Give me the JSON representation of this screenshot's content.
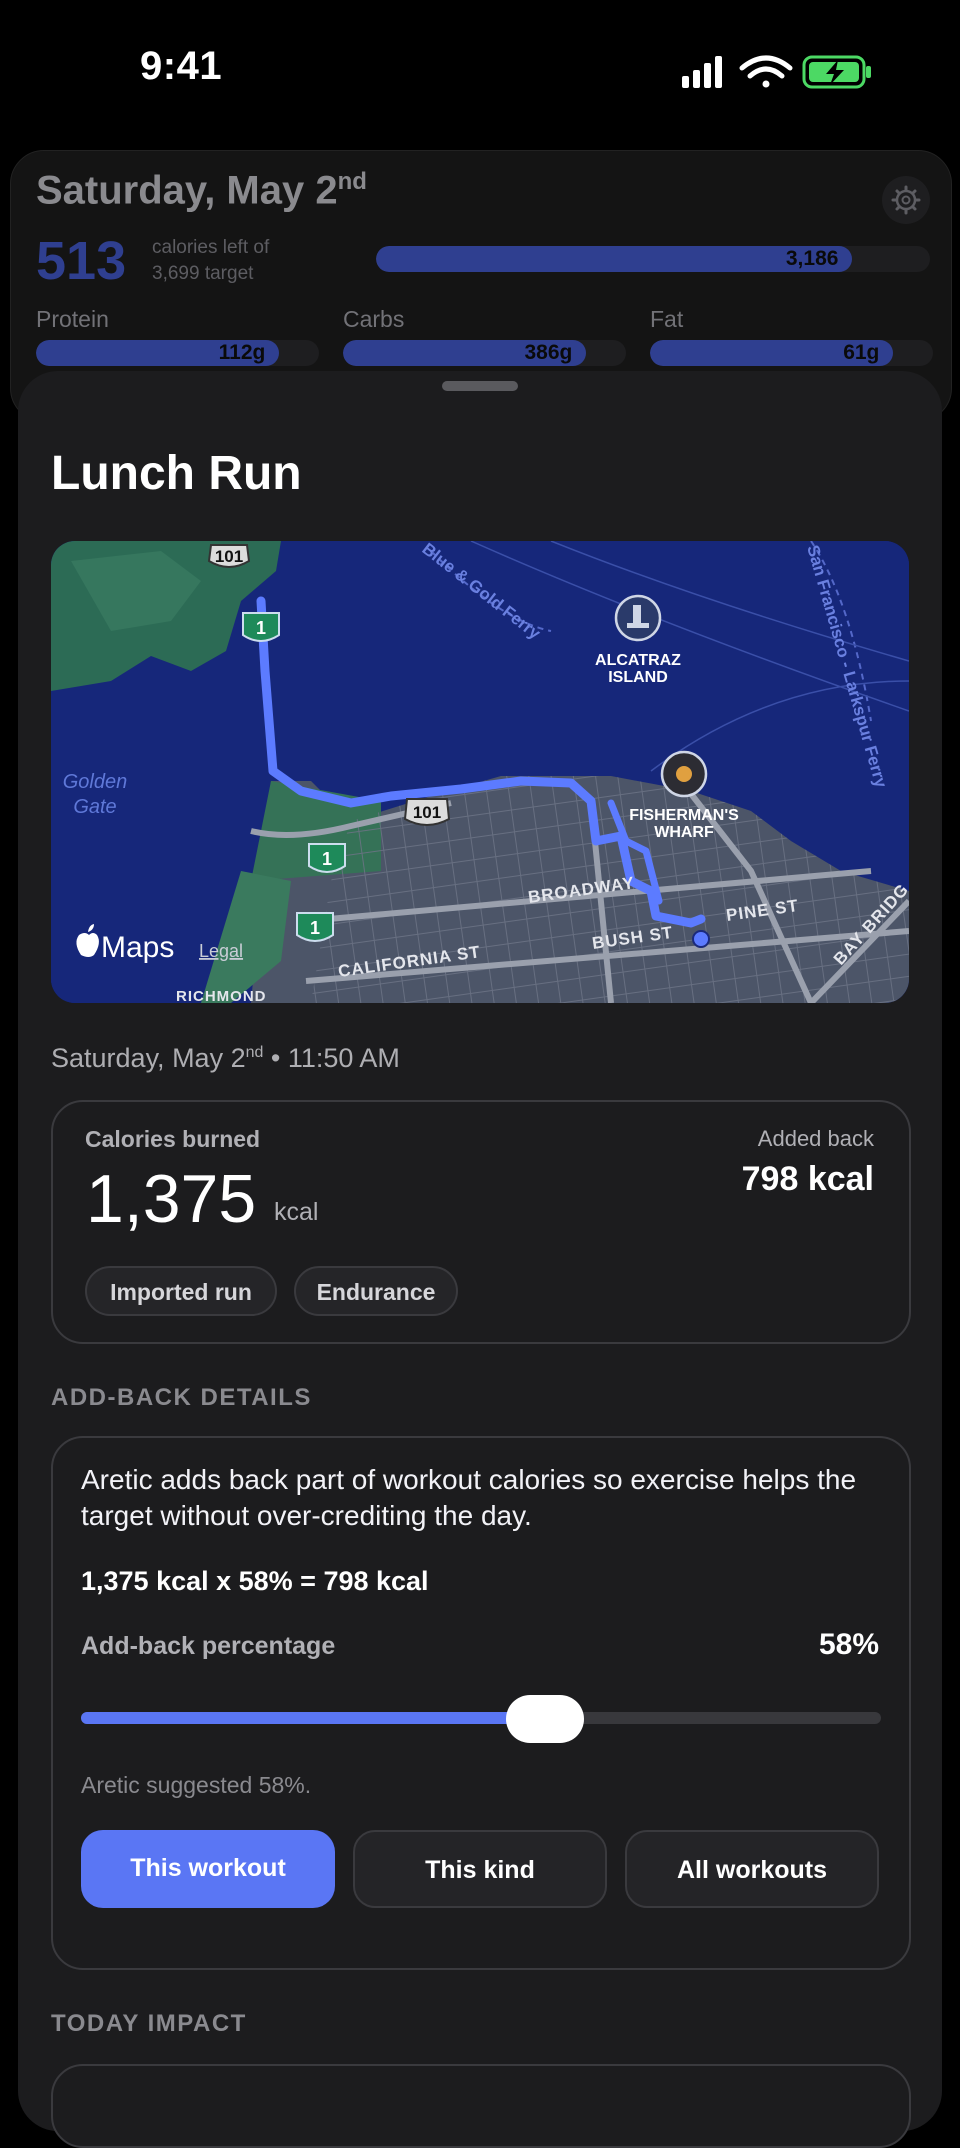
{
  "status": {
    "time": "9:41"
  },
  "summary": {
    "date": "Saturday, May 2",
    "date_suffix": "nd",
    "calories_left": "513",
    "left_line1": "calories left of",
    "left_line2": "3,699 target",
    "eaten_value": "3,186",
    "eaten_fraction": 0.86,
    "macros": [
      {
        "label": "Protein",
        "value": "112g",
        "fraction": 0.86
      },
      {
        "label": "Carbs",
        "value": "386g",
        "fraction": 0.86
      },
      {
        "label": "Fat",
        "value": "61g",
        "fraction": 0.86
      }
    ]
  },
  "workout": {
    "title": "Lunch Run",
    "date": "Saturday, May 2",
    "date_suffix": "nd",
    "time_sep": " • 11:50 AM",
    "calories_label": "Calories burned",
    "calories_value": "1,375",
    "calories_unit": "kcal",
    "added_label": "Added back",
    "added_value": "798 kcal",
    "chips": [
      "Imported run",
      "Endurance"
    ]
  },
  "map": {
    "brand": "Maps",
    "legal": "Legal",
    "labels": {
      "alcatraz1": "ALCATRAZ",
      "alcatraz2": "ISLAND",
      "fisherman1": "FISHERMAN'S",
      "fisherman2": "WHARF",
      "golden1": "Golden",
      "golden2": "Gate",
      "ferry": "Blue & Gold Ferry",
      "larkspur": "San Francisco - Larkspur Ferry",
      "broadway": "BROADWAY",
      "pine": "PINE ST",
      "bush": "BUSH ST",
      "california": "CALIFORNIA ST",
      "richmond": "RICHMOND",
      "baybridge": "BAY BRIDG",
      "hwy101": "101",
      "hwy1": "1"
    }
  },
  "addback": {
    "section_title": "ADD-BACK DETAILS",
    "description": "Aretic adds back part of workout calories so exercise helps the target without over-crediting the day.",
    "formula": "1,375 kcal x 58% = 798 kcal",
    "percentage_label": "Add-back percentage",
    "percentage_value": "58%",
    "percentage": 0.58,
    "suggested": "Aretic suggested 58%.",
    "scope_options": [
      "This workout",
      "This kind",
      "All workouts"
    ],
    "selected_scope": "This workout"
  },
  "impact": {
    "section_title": "TODAY IMPACT"
  },
  "colors": {
    "accent": "#5a76f4",
    "sheet": "#1c1c1e",
    "route": "#5c7bff"
  }
}
